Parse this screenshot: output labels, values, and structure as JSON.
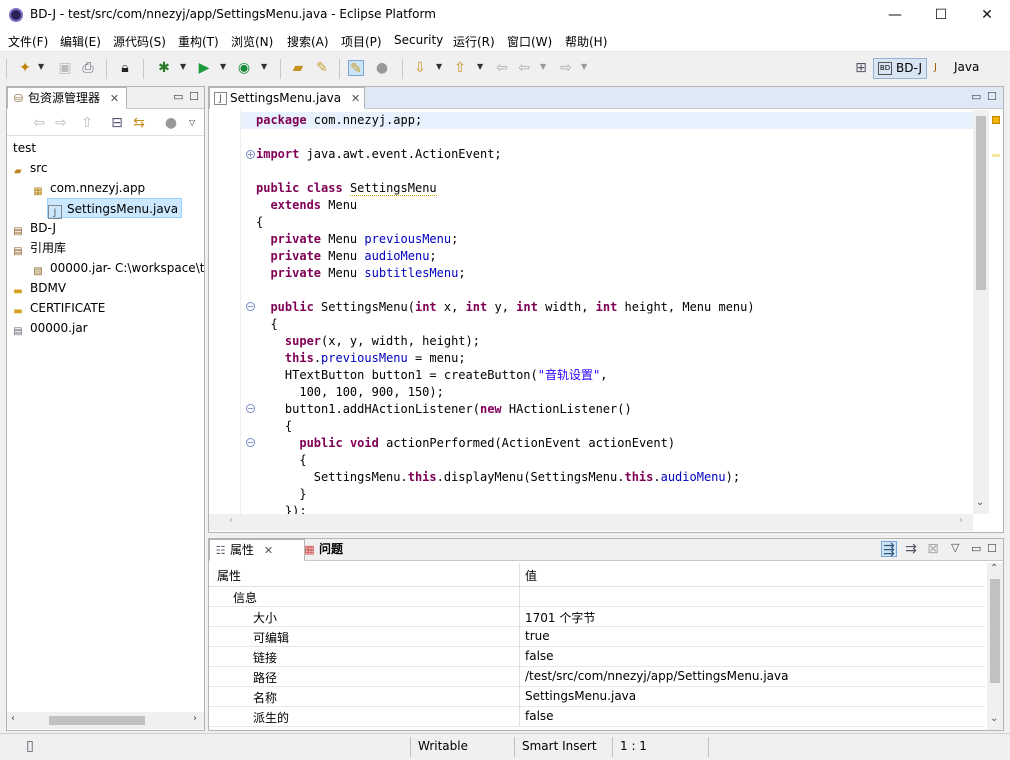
{
  "window": {
    "title": "BD-J  -  test/src/com/nnezyj/app/SettingsMenu.java  -  Eclipse Platform",
    "minimize": "—",
    "maximize": "☐",
    "close": "✕"
  },
  "menubar": {
    "items": [
      "文件(F)",
      "编辑(E)",
      "源代码(S)",
      "重构(T)",
      "浏览(N)",
      "搜索(A)",
      "项目(P)",
      "Security",
      "运行(R)",
      "窗口(W)",
      "帮助(H)"
    ]
  },
  "perspectives": {
    "items": [
      "BD-J",
      "Java"
    ]
  },
  "package_explorer": {
    "tab_label": "包资源管理器",
    "tree": [
      {
        "label": "test",
        "icon": "none",
        "indent": 0
      },
      {
        "label": "src",
        "icon": "package-folder-icon",
        "indent": 0
      },
      {
        "label": "com.nnezyj.app",
        "icon": "package-icon",
        "indent": 1
      },
      {
        "label": "SettingsMenu.java",
        "icon": "java-file-icon",
        "indent": 2,
        "selected": true
      },
      {
        "label": "BD-J",
        "icon": "library-icon",
        "indent": 0
      },
      {
        "label": "引用库",
        "icon": "library-icon",
        "indent": 0
      },
      {
        "label": "00000.jar- C:\\workspace\\t",
        "icon": "jar-icon",
        "indent": 1
      },
      {
        "label": "BDMV",
        "icon": "folder-icon",
        "indent": 0
      },
      {
        "label": "CERTIFICATE",
        "icon": "folder-icon",
        "indent": 0
      },
      {
        "label": "00000.jar",
        "icon": "jar-file-icon",
        "indent": 0
      }
    ]
  },
  "editor": {
    "tab_label": "SettingsMenu.java"
  },
  "properties": {
    "tab_label": "属性",
    "problems_tab_label": "问题",
    "header_key": "属性",
    "header_value": "值",
    "group": "信息",
    "rows": [
      {
        "key": "大小",
        "value": "1701 个字节"
      },
      {
        "key": "可编辑",
        "value": "true"
      },
      {
        "key": "链接",
        "value": "false"
      },
      {
        "key": "路径",
        "value": "/test/src/com/nnezyj/app/SettingsMenu.java"
      },
      {
        "key": "名称",
        "value": "SettingsMenu.java"
      },
      {
        "key": "派生的",
        "value": "false"
      }
    ]
  },
  "statusbar": {
    "writable": "Writable",
    "insert_mode": "Smart Insert",
    "position": "1 : 1"
  },
  "colors": {
    "keyword": "#7f0055",
    "field": "#0000c0",
    "string": "#2a00ff",
    "current_line": "#e8f2fe"
  }
}
